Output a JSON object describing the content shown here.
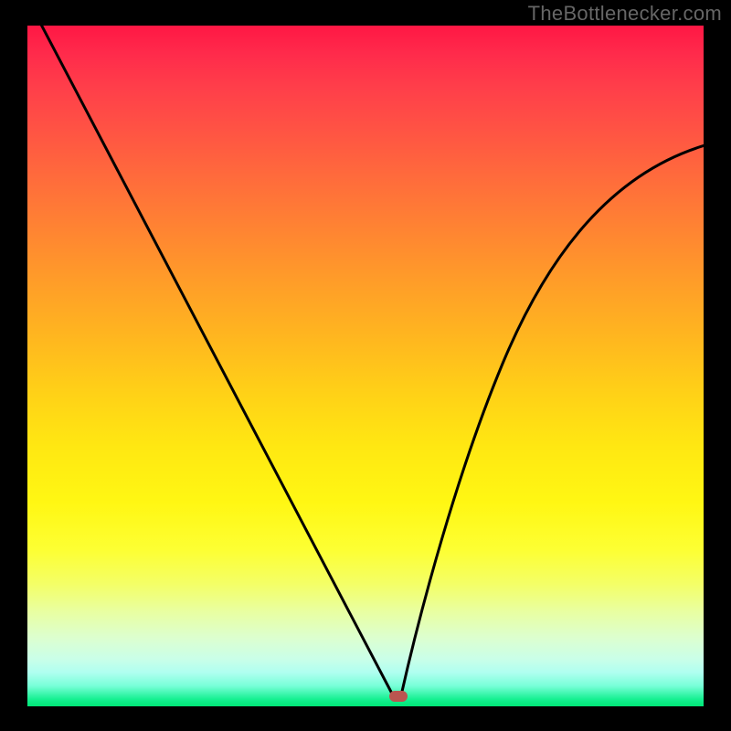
{
  "watermark": "TheBottlenecker.com",
  "chart_data": {
    "type": "line",
    "title": "",
    "xlabel": "",
    "ylabel": "",
    "xlim": [
      0,
      1
    ],
    "ylim": [
      0,
      1
    ],
    "background_gradient": {
      "orientation": "vertical",
      "stops": [
        {
          "pos": 0.0,
          "color": "#ff1744"
        },
        {
          "pos": 0.3,
          "color": "#ff8432"
        },
        {
          "pos": 0.6,
          "color": "#ffe812"
        },
        {
          "pos": 0.85,
          "color": "#e9ffa0"
        },
        {
          "pos": 1.0,
          "color": "#00e676"
        }
      ]
    },
    "series": [
      {
        "name": "bottleneck-curve",
        "x": [
          0.0,
          0.05,
          0.1,
          0.15,
          0.2,
          0.25,
          0.3,
          0.35,
          0.4,
          0.45,
          0.5,
          0.52,
          0.55,
          0.58,
          0.6,
          0.65,
          0.7,
          0.75,
          0.8,
          0.85,
          0.9,
          0.95,
          1.0
        ],
        "y": [
          1.0,
          0.91,
          0.82,
          0.73,
          0.63,
          0.54,
          0.45,
          0.36,
          0.26,
          0.16,
          0.06,
          0.02,
          0.0,
          0.03,
          0.08,
          0.22,
          0.36,
          0.48,
          0.58,
          0.67,
          0.73,
          0.79,
          0.83
        ]
      }
    ],
    "marker": {
      "x": 0.55,
      "y": 0.0,
      "color": "#bb5550",
      "shape": "pill"
    }
  }
}
